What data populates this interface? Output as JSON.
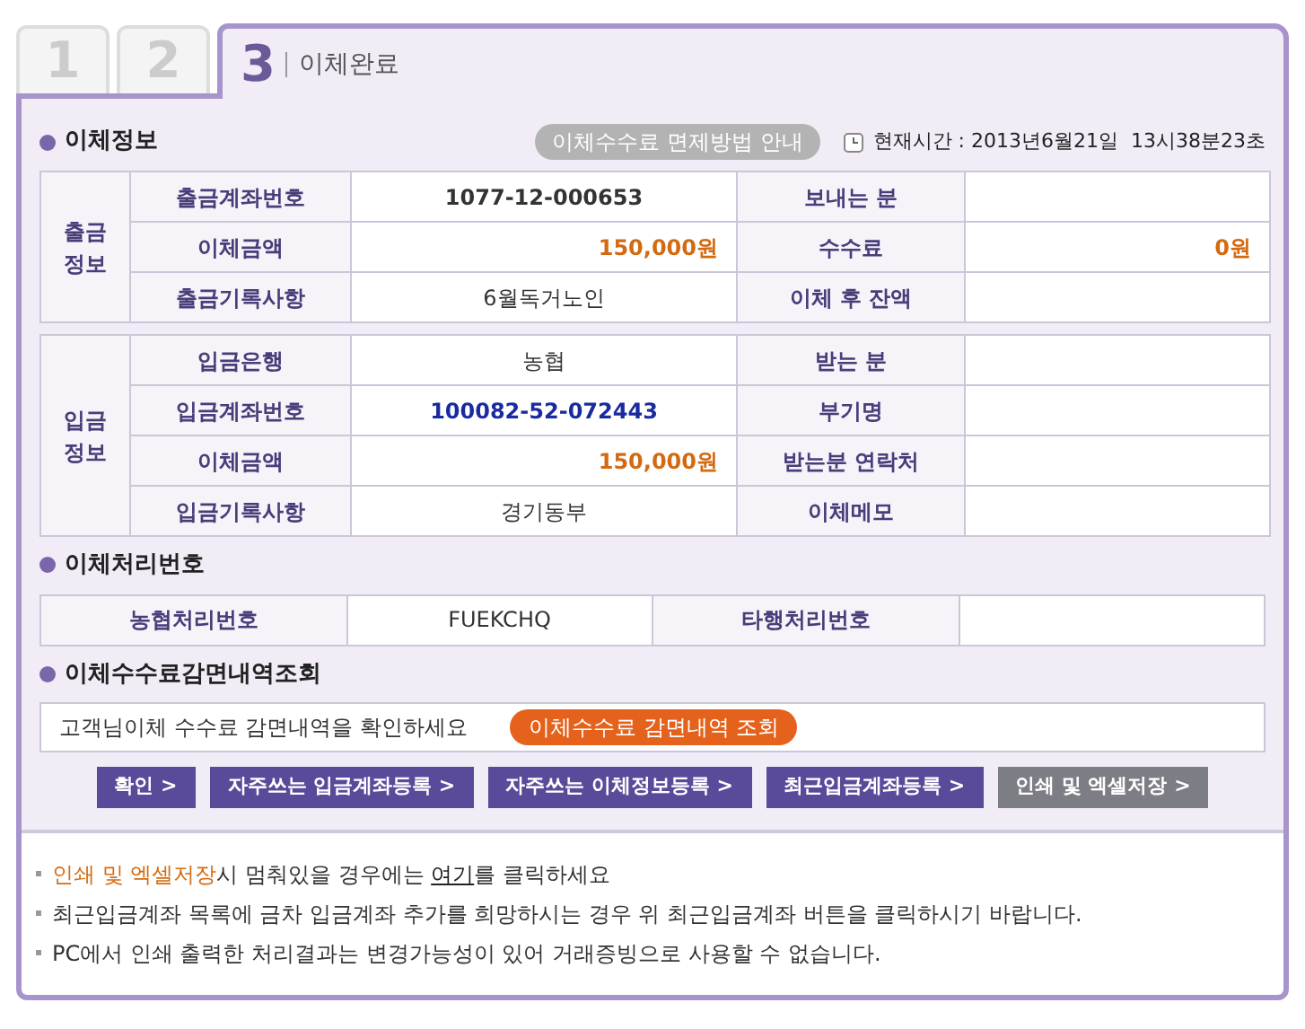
{
  "tabs": [
    {
      "number": "1",
      "selected": false
    },
    {
      "number": "2",
      "selected": false
    },
    {
      "number": "3",
      "label": "이체완료",
      "selected": true
    }
  ],
  "transfer_info": {
    "title": "이체정보",
    "guide_button": "이체수수료 면제방법 안내",
    "current_time": "현재시간 : 2013년6월21일  13시38분23초",
    "groups": [
      {
        "heading": "출금\n정보",
        "rows": [
          [
            {
              "label": "출금계좌번호",
              "value": "1077-12-000653",
              "kind": "bold"
            },
            {
              "label": "보내는 분"
            }
          ],
          [
            {
              "label": "이체금액",
              "value": "150,000원",
              "kind": "amount"
            },
            {
              "label": "수수료",
              "value": "0원",
              "kind": "amount"
            }
          ],
          [
            {
              "label": "출금기록사항",
              "value": "6월독거노인",
              "kind": "plain"
            },
            {
              "label": "이체 후 잔액"
            }
          ]
        ]
      },
      {
        "heading": "입금\n정보",
        "rows": [
          [
            {
              "label": "입금은행",
              "value": "농협",
              "kind": "plain"
            },
            {
              "label": "받는 분"
            }
          ],
          [
            {
              "label": "입금계좌번호",
              "value": "100082-52-072443",
              "kind": "account"
            },
            {
              "label": "부기명"
            }
          ],
          [
            {
              "label": "이체금액",
              "value": "150,000원",
              "kind": "amount"
            },
            {
              "label": "받는분 연락처"
            }
          ],
          [
            {
              "label": "입금기록사항",
              "value": "경기동부",
              "kind": "plain"
            },
            {
              "label": "이체메모"
            }
          ]
        ]
      }
    ]
  },
  "processing": {
    "title": "이체처리번호",
    "cells": [
      {
        "label": "농협처리번호",
        "value": "FUEKCHQ"
      },
      {
        "label": "타행처리번호"
      }
    ]
  },
  "fee_reduction": {
    "title": "이체수수료감면내역조회",
    "message": "고객님이체 수수료 감면내역을 확인하세요",
    "button": "이체수수료 감면내역 조회"
  },
  "buttons": [
    {
      "label": "확인 >",
      "kind": "primary"
    },
    {
      "label": "자주쓰는 입금계좌등록 >",
      "kind": "primary"
    },
    {
      "label": "자주쓰는 이체정보등록 >",
      "kind": "primary"
    },
    {
      "label": "최근입금계좌등록 >",
      "kind": "primary"
    },
    {
      "label": "인쇄 및 엑셀저장 >",
      "kind": "secondary"
    }
  ],
  "notes": [
    [
      {
        "text": "인쇄 및 엑셀저장",
        "kind": "highlight"
      },
      {
        "text": "시 멈춰있을 경우에는 ",
        "kind": "plain"
      },
      {
        "text": "여기",
        "kind": "link"
      },
      {
        "text": "를 클릭하세요",
        "kind": "plain"
      }
    ],
    [
      {
        "text": "최근입금계좌 목록에 금차 입금계좌 추가를 희망하시는 경우 위 최근입금계좌 버튼을 클릭하시기 바랍니다.",
        "kind": "plain"
      }
    ],
    [
      {
        "text": "PC에서 인쇄 출력한 처리결과는 변경가능성이 있어 거래증빙으로 사용할 수 없습니다.",
        "kind": "plain"
      }
    ]
  ]
}
